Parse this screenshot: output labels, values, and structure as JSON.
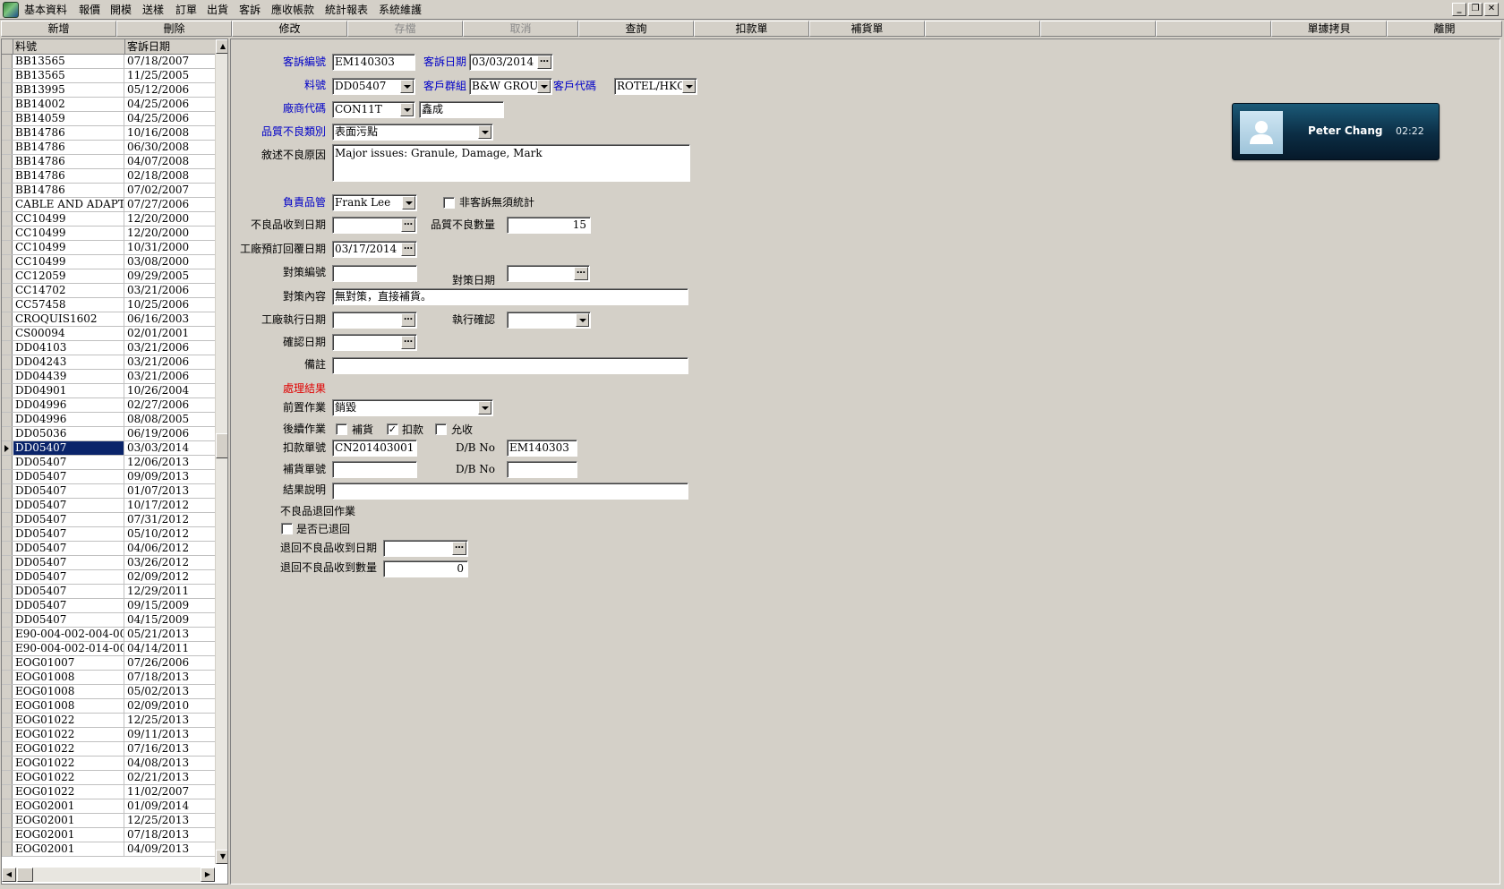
{
  "menu": [
    "基本資料",
    "報價",
    "開模",
    "送樣",
    "訂單",
    "出貨",
    "客訴",
    "應收帳款",
    "統計報表",
    "系統維護"
  ],
  "window_buttons": {
    "minimize": "_",
    "restore": "❐",
    "close": "✕"
  },
  "toolbar": [
    {
      "label": "新增",
      "enabled": true
    },
    {
      "label": "刪除",
      "enabled": true
    },
    {
      "label": "修改",
      "enabled": true
    },
    {
      "label": "存檔",
      "enabled": false
    },
    {
      "label": "取消",
      "enabled": false
    },
    {
      "label": "查詢",
      "enabled": true
    },
    {
      "label": "扣款單",
      "enabled": true
    },
    {
      "label": "補貨單",
      "enabled": true
    },
    {
      "label": "",
      "enabled": true
    },
    {
      "label": "",
      "enabled": true
    },
    {
      "label": "",
      "enabled": true
    },
    {
      "label": "單據拷貝",
      "enabled": true
    },
    {
      "label": "離開",
      "enabled": true
    }
  ],
  "grid": {
    "columns": [
      "料號",
      "客訴日期"
    ],
    "selected_index": 27,
    "rows": [
      [
        "BB13565",
        "07/18/2007"
      ],
      [
        "BB13565",
        "11/25/2005"
      ],
      [
        "BB13995",
        "05/12/2006"
      ],
      [
        "BB14002",
        "04/25/2006"
      ],
      [
        "BB14059",
        "04/25/2006"
      ],
      [
        "BB14786",
        "10/16/2008"
      ],
      [
        "BB14786",
        "06/30/2008"
      ],
      [
        "BB14786",
        "04/07/2008"
      ],
      [
        "BB14786",
        "02/18/2008"
      ],
      [
        "BB14786",
        "07/02/2007"
      ],
      [
        "CABLE AND ADAPTOR",
        "07/27/2006"
      ],
      [
        "CC10499",
        "12/20/2000"
      ],
      [
        "CC10499",
        "12/20/2000"
      ],
      [
        "CC10499",
        "10/31/2000"
      ],
      [
        "CC10499",
        "03/08/2000"
      ],
      [
        "CC12059",
        "09/29/2005"
      ],
      [
        "CC14702",
        "03/21/2006"
      ],
      [
        "CC57458",
        "10/25/2006"
      ],
      [
        "CROQUIS1602",
        "06/16/2003"
      ],
      [
        "CS00094",
        "02/01/2001"
      ],
      [
        "DD04103",
        "03/21/2006"
      ],
      [
        "DD04243",
        "03/21/2006"
      ],
      [
        "DD04439",
        "03/21/2006"
      ],
      [
        "DD04901",
        "10/26/2004"
      ],
      [
        "DD04996",
        "02/27/2006"
      ],
      [
        "DD04996",
        "08/08/2005"
      ],
      [
        "DD05036",
        "06/19/2006"
      ],
      [
        "DD05407",
        "03/03/2014"
      ],
      [
        "DD05407",
        "12/06/2013"
      ],
      [
        "DD05407",
        "09/09/2013"
      ],
      [
        "DD05407",
        "01/07/2013"
      ],
      [
        "DD05407",
        "10/17/2012"
      ],
      [
        "DD05407",
        "07/31/2012"
      ],
      [
        "DD05407",
        "05/10/2012"
      ],
      [
        "DD05407",
        "04/06/2012"
      ],
      [
        "DD05407",
        "03/26/2012"
      ],
      [
        "DD05407",
        "02/09/2012"
      ],
      [
        "DD05407",
        "12/29/2011"
      ],
      [
        "DD05407",
        "09/15/2009"
      ],
      [
        "DD05407",
        "04/15/2009"
      ],
      [
        "E90-004-002-004-00",
        "05/21/2013"
      ],
      [
        "E90-004-002-014-00",
        "04/14/2011"
      ],
      [
        "EOG01007",
        "07/26/2006"
      ],
      [
        "EOG01008",
        "07/18/2013"
      ],
      [
        "EOG01008",
        "05/02/2013"
      ],
      [
        "EOG01008",
        "02/09/2010"
      ],
      [
        "EOG01022",
        "12/25/2013"
      ],
      [
        "EOG01022",
        "09/11/2013"
      ],
      [
        "EOG01022",
        "07/16/2013"
      ],
      [
        "EOG01022",
        "04/08/2013"
      ],
      [
        "EOG01022",
        "02/21/2013"
      ],
      [
        "EOG01022",
        "11/02/2007"
      ],
      [
        "EOG02001",
        "01/09/2014"
      ],
      [
        "EOG02001",
        "12/25/2013"
      ],
      [
        "EOG02001",
        "07/18/2013"
      ],
      [
        "EOG02001",
        "04/09/2013"
      ]
    ]
  },
  "form": {
    "complaint_no_label": "客訴編號",
    "complaint_no": "EM140303",
    "complaint_date_label": "客訴日期",
    "complaint_date": "03/03/2014",
    "part_no_label": "料號",
    "part_no": "DD05407",
    "customer_group_label": "客戶群組",
    "customer_group": "B&W GROUP",
    "customer_code_label": "客戶代碼",
    "customer_code": "ROTEL/HKG",
    "vendor_code_label": "廠商代碼",
    "vendor_code": "CON11T",
    "vendor_name": "鑫成",
    "defect_type_label": "品質不良類別",
    "defect_type": "表面污點",
    "defect_reason_label": "敘述不良原因",
    "defect_reason": "Major issues: Granule, Damage, Mark",
    "qc_owner_label": "負責品管",
    "qc_owner": "Frank Lee",
    "no_stat_label": "非客訴無須統計",
    "defect_received_date_label": "不良品收到日期",
    "defect_received_date": "",
    "defect_qty_label": "品質不良數量",
    "defect_qty": "15",
    "factory_reply_date_label": "工廠預訂回覆日期",
    "factory_reply_date": "03/17/2014",
    "measure_no_label": "對策編號",
    "measure_no": "",
    "measure_date_label": "對策日期",
    "measure_date": "",
    "measure_content_label": "對策內容",
    "measure_content": "無對策，直接補貨。",
    "factory_exec_date_label": "工廠執行日期",
    "factory_exec_date": "",
    "exec_confirm_label": "執行確認",
    "exec_confirm": "",
    "confirm_date_label": "確認日期",
    "confirm_date": "",
    "remark_label": "備註",
    "remark": "",
    "result_header": "處理結果",
    "pre_operation_label": "前置作業",
    "pre_operation": "銷毀",
    "follow_up_label": "後續作業",
    "follow_replenish_label": "補貨",
    "follow_replenish": false,
    "follow_deduct_label": "扣款",
    "follow_deduct": true,
    "follow_accept_label": "允收",
    "follow_accept": false,
    "deduction_no_label": "扣款單號",
    "deduction_no": "CN201403001",
    "db_no_label_1": "D/B No",
    "db_no_1": "EM140303",
    "replenish_no_label": "補貨單號",
    "replenish_no": "",
    "db_no_label_2": "D/B No",
    "db_no_2": "",
    "result_desc_label": "結果說明",
    "result_desc": "",
    "return_header": "不良品退回作業",
    "returned_label": "是否已退回",
    "returned": false,
    "return_received_date_label": "退回不良品收到日期",
    "return_received_date": "",
    "return_received_qty_label": "退回不良品收到數量",
    "return_received_qty": "0"
  },
  "notification": {
    "name": "Peter Chang",
    "time": "02:22",
    "icon": "user-avatar-icon"
  },
  "icons": {
    "dropdown": "chevron-down-icon",
    "date_picker": "ellipsis-icon"
  },
  "colors": {
    "label_blue": "#0000c8",
    "label_red": "#e00000",
    "selection": "#0a246a",
    "face": "#d4d0c8"
  }
}
